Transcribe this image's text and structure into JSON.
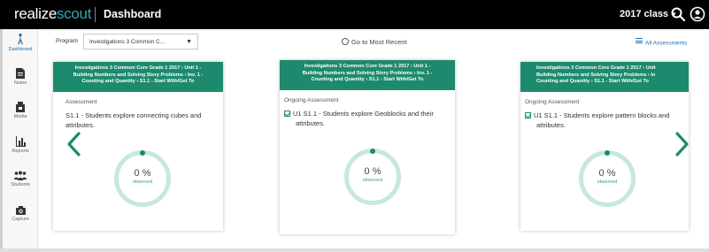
{
  "header": {
    "logo_realize": "realize",
    "logo_scout": "scout",
    "page_title": "Dashboard",
    "class_selector": "2017 class",
    "search_icon": "search-icon",
    "user_icon": "user-icon"
  },
  "sidebar": {
    "items": [
      {
        "label": "Dashboard",
        "icon": "dashboard-icon",
        "active": true
      },
      {
        "label": "Notes",
        "icon": "notes-icon"
      },
      {
        "label": "Media",
        "icon": "media-icon"
      },
      {
        "label": "Reports",
        "icon": "reports-icon"
      },
      {
        "label": "Students",
        "icon": "students-icon"
      },
      {
        "label": "Capture",
        "icon": "capture-icon"
      }
    ]
  },
  "toolbar": {
    "program_label": "Program",
    "program_value": "Investigations 3 Common C...",
    "goto_recent": "Go to Most Recent",
    "all_assessments": "All Assessments"
  },
  "cards": [
    {
      "header_lines": [
        "Investigations 3 Common Core Grade 1 2017 › Unit 1 -",
        "Building Numbers and Solving Story Problems › Inv. 1 -",
        "Counting and Quantity › S1.1 - Start With/Get To"
      ],
      "type": "Assessment",
      "skill": "S1.1 - Students explore connecting cubes and",
      "skill_line2": "attributes.",
      "percent": "0 %",
      "observed": "observed"
    },
    {
      "header_lines": [
        "Investigations 3 Common Core Grade 1 2017 › Unit 1 -",
        "Building Numbers and Solving Story Problems › Inv. 1 -",
        "Counting and Quantity › S1.1 - Start With/Get To"
      ],
      "type": "Ongoing Assessment",
      "skill": "U1 S1.1 - Students explore Geoblocks and their",
      "skill_line2": "attributes.",
      "percent": "0 %",
      "observed": "observed"
    },
    {
      "header_lines": [
        "Investigations 3 Common Core Grade 1 2017 › Unit",
        "Building Numbers and Solving Story Problems › In",
        "Counting and Quantity › S1.1 - Start With/Get To"
      ],
      "type": "Ongoing Assessment",
      "skill": "U1 S1.1 - Students explore pattern blocks and",
      "skill_line2": "attributes.",
      "percent": "0 %",
      "observed": "observed"
    }
  ],
  "colors": {
    "brand_green": "#1d8a6e",
    "ring_light": "#c6e8df",
    "link_blue": "#1e6fb0",
    "topbar": "#000000",
    "scout_teal": "#2ea8b8"
  }
}
